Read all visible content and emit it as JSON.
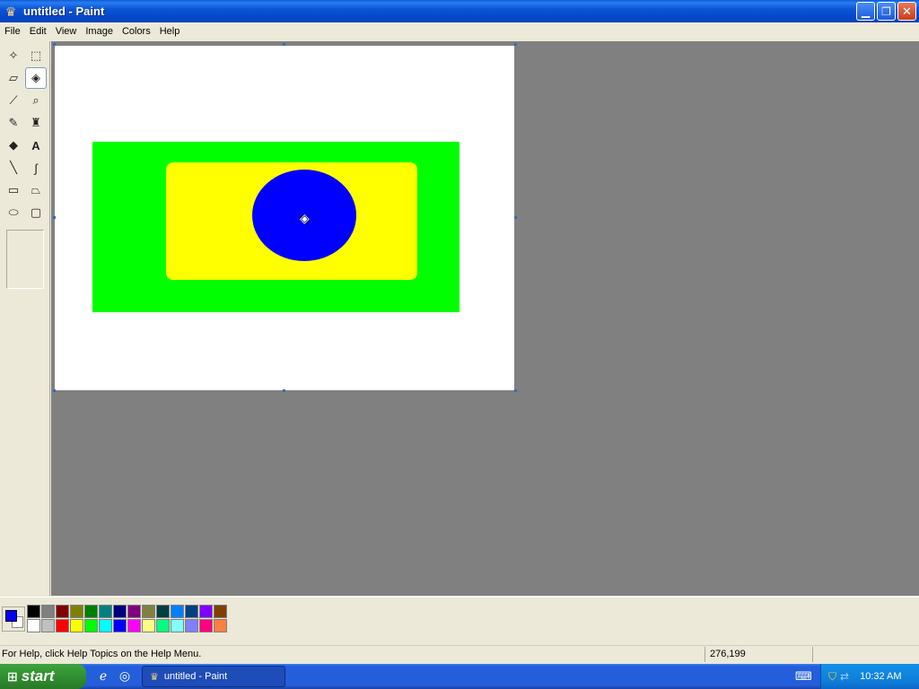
{
  "window": {
    "title": "untitled - Paint",
    "icon": "paint-app-icon"
  },
  "title_buttons": {
    "minimize": "minimize-icon",
    "maximize": "restore-icon",
    "close": "close-icon"
  },
  "menu": [
    "File",
    "Edit",
    "View",
    "Image",
    "Colors",
    "Help"
  ],
  "tools": [
    {
      "name": "free-form-select",
      "glyph": "✧"
    },
    {
      "name": "select",
      "glyph": "⬚"
    },
    {
      "name": "eraser",
      "glyph": "▱"
    },
    {
      "name": "fill-with-color",
      "glyph": "◈",
      "active": true
    },
    {
      "name": "pick-color",
      "glyph": "⟋"
    },
    {
      "name": "magnifier",
      "glyph": "⌕"
    },
    {
      "name": "pencil",
      "glyph": "✎"
    },
    {
      "name": "brush",
      "glyph": "♜"
    },
    {
      "name": "airbrush",
      "glyph": "◆"
    },
    {
      "name": "text",
      "glyph": "A"
    },
    {
      "name": "line",
      "glyph": "╲"
    },
    {
      "name": "curve",
      "glyph": "∫"
    },
    {
      "name": "rectangle",
      "glyph": "▭"
    },
    {
      "name": "polygon",
      "glyph": "⏢"
    },
    {
      "name": "ellipse",
      "glyph": "⬭"
    },
    {
      "name": "rounded-rectangle",
      "glyph": "▢"
    }
  ],
  "canvas": {
    "background": "#FFFFFF",
    "shapes": {
      "outer_rectangle_color": "#00FF00",
      "inner_rounded_rectangle_color": "#FFFF00",
      "ellipse_color": "#0000FF"
    }
  },
  "current_colors": {
    "foreground": "#0000FF",
    "background": "#FFFFFF"
  },
  "palette": {
    "row1": [
      "#000000",
      "#808080",
      "#800000",
      "#808000",
      "#008000",
      "#008080",
      "#000080",
      "#800080",
      "#808040",
      "#004040",
      "#0080FF",
      "#004080",
      "#8000FF",
      "#804000"
    ],
    "row2": [
      "#FFFFFF",
      "#C0C0C0",
      "#FF0000",
      "#FFFF00",
      "#00FF00",
      "#00FFFF",
      "#0000FF",
      "#FF00FF",
      "#FFFF80",
      "#00FF80",
      "#80FFFF",
      "#8080FF",
      "#FF0080",
      "#FF8040"
    ]
  },
  "status": {
    "help_text": "For Help, click Help Topics on the Help Menu.",
    "coordinates": "276,199"
  },
  "taskbar": {
    "start_label": "start",
    "task_label": "untitled - Paint",
    "clock": "10:32 AM"
  }
}
